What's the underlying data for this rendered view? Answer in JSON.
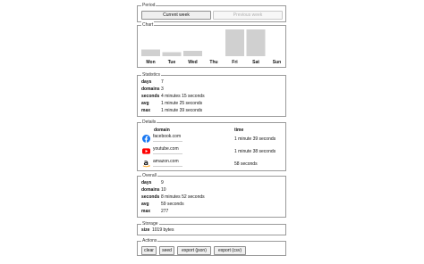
{
  "period": {
    "legend": "Period",
    "current_label": "Current week",
    "previous_label": "Previous week"
  },
  "chart": {
    "legend": "Chart"
  },
  "chart_data": {
    "type": "bar",
    "categories": [
      "Mon",
      "Tue",
      "Wed",
      "Thu",
      "Fri",
      "Sat",
      "Sun"
    ],
    "values": [
      0.25,
      0.15,
      0.2,
      0,
      1.0,
      1.0,
      0
    ],
    "ylim": [
      0,
      1
    ],
    "bar_color": "#d0d0d0",
    "grid": false
  },
  "statistics": {
    "legend": "Statistics",
    "rows": [
      {
        "key": "days",
        "value": "7"
      },
      {
        "key": "domains",
        "value": "3"
      },
      {
        "key": "seconds",
        "value": "4 minutes 15 seconds"
      },
      {
        "key": "avg",
        "value": "1 minute 25 seconds"
      },
      {
        "key": "max",
        "value": "1 minute 39 seconds"
      }
    ]
  },
  "details": {
    "legend": "Details",
    "col_domain": "domain",
    "col_time": "time",
    "rows": [
      {
        "domain": "facebook.com",
        "time": "1 minute 39 seconds",
        "icon": "facebook-icon"
      },
      {
        "domain": "youtube.com",
        "time": "1 minute 38 seconds",
        "icon": "youtube-icon"
      },
      {
        "domain": "amazon.com",
        "time": "58 seconds",
        "icon": "amazon-icon"
      }
    ]
  },
  "overall": {
    "legend": "Overall",
    "rows": [
      {
        "key": "days",
        "value": "9"
      },
      {
        "key": "domains",
        "value": "10"
      },
      {
        "key": "seconds",
        "value": "8 minutes 52 seconds"
      },
      {
        "key": "avg",
        "value": "59 seconds"
      },
      {
        "key": "max",
        "value": "277"
      }
    ]
  },
  "storage": {
    "legend": "Storage",
    "key": "size",
    "value": "1019 bytes"
  },
  "actions": {
    "legend": "Actions",
    "clear": "clear",
    "seed": "seed",
    "export_json": "export (json)",
    "export_csv": "export (csv)"
  },
  "colors": {
    "facebook": "#1877f2",
    "youtube": "#ff0000",
    "amazon": "#111111",
    "amazon_smile": "#ff9900"
  }
}
